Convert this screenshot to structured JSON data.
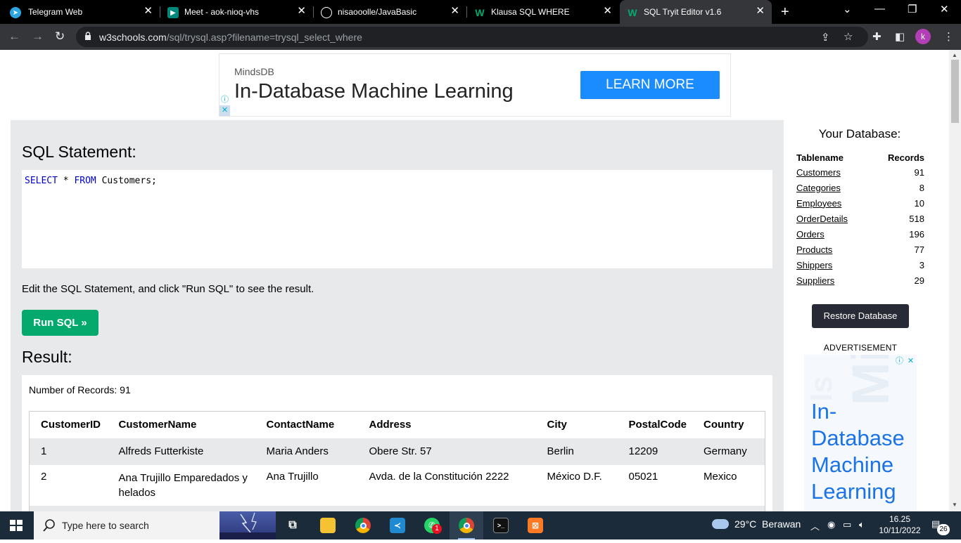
{
  "browser": {
    "tabs": [
      {
        "title": "Telegram Web",
        "icon": "telegram-icon",
        "color": "#2ca5e0"
      },
      {
        "title": "Meet - aok-nioq-vhs",
        "icon": "google-meet-icon",
        "color": "#00897b"
      },
      {
        "title": "nisaooolle/JavaBasic",
        "icon": "github-icon",
        "color": "#ffffff"
      },
      {
        "title": "Klausa SQL WHERE",
        "icon": "w3schools-icon",
        "color": "#04aa6d"
      },
      {
        "title": "SQL Tryit Editor v1.6",
        "icon": "w3schools-icon",
        "color": "#04aa6d"
      }
    ],
    "url_host": "w3schools.com",
    "url_path": "/sql/trysql.asp?filename=trysql_select_where",
    "profile_initial": "k"
  },
  "top_ad": {
    "brand": "MindsDB",
    "headline": "In-Database Machine Learning",
    "cta": "LEARN MORE"
  },
  "editor": {
    "sql_heading": "SQL Statement:",
    "code_kw1": "SELECT",
    "code_mid": " * ",
    "code_kw2": "FROM",
    "code_rest": " Customers;",
    "instruction": "Edit the SQL Statement, and click \"Run SQL\" to see the result.",
    "run_label": "Run SQL »",
    "result_heading": "Result:",
    "record_count": "Number of Records: 91"
  },
  "result": {
    "headers": [
      "CustomerID",
      "CustomerName",
      "ContactName",
      "Address",
      "City",
      "PostalCode",
      "Country"
    ],
    "rows": [
      [
        "1",
        "Alfreds Futterkiste",
        "Maria Anders",
        "Obere Str. 57",
        "Berlin",
        "12209",
        "Germany"
      ],
      [
        "2",
        "Ana Trujillo Emparedados y helados",
        "Ana Trujillo",
        "Avda. de la Constitución 2222",
        "México D.F.",
        "05021",
        "Mexico"
      ]
    ]
  },
  "database": {
    "title": "Your Database:",
    "col_name": "Tablename",
    "col_records": "Records",
    "tables": [
      {
        "name": "Customers",
        "records": "91"
      },
      {
        "name": "Categories",
        "records": "8"
      },
      {
        "name": "Employees",
        "records": "10"
      },
      {
        "name": "OrderDetails",
        "records": "518"
      },
      {
        "name": "Orders",
        "records": "196"
      },
      {
        "name": "Products",
        "records": "77"
      },
      {
        "name": "Shippers",
        "records": "3"
      },
      {
        "name": "Suppliers",
        "records": "29"
      }
    ],
    "restore_label": "Restore Database",
    "ad_label": "ADVERTISEMENT",
    "side_ad_headline": "In-Database Machine Learning"
  },
  "taskbar": {
    "search_placeholder": "Type here to search",
    "weather": "29°C  Berawan",
    "time": "16.25",
    "date": "10/11/2022",
    "notifications": "26",
    "whatsapp_badge": "1"
  },
  "colors": {
    "accent_green": "#04aa6d",
    "panel_bg": "#e7e9eb",
    "dark_button": "#282a35",
    "ad_blue": "#1a8cff"
  }
}
